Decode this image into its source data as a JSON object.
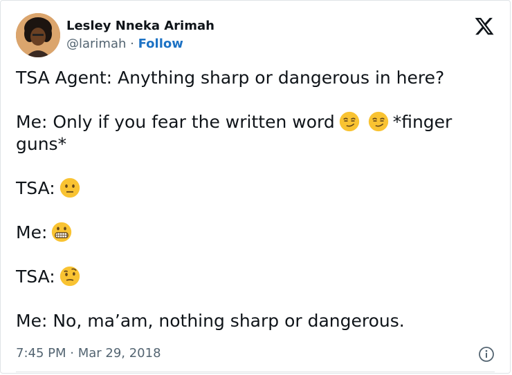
{
  "author": {
    "display_name": "Lesley Nneka Arimah",
    "handle": "@larimah",
    "separator": "·",
    "follow_label": "Follow"
  },
  "tweet": {
    "line1": "TSA Agent: Anything sharp or dangerous in here?",
    "line2_text": "Me: Only if you fear the written word",
    "line2_tail": "*finger guns*",
    "line3": "TSA:",
    "line4": "Me:",
    "line5": "TSA:",
    "line6": "Me: No, ma’am, nothing sharp or dangerous."
  },
  "meta": {
    "timestamp": "7:45 PM · Mar 29, 2018"
  },
  "icons": {
    "brand": "x-logo-icon",
    "info": "info-icon",
    "emojis": [
      "smirking-face",
      "smirking-face",
      "neutral-face",
      "grimacing-face",
      "face-with-raised-eyebrow"
    ]
  },
  "colors": {
    "text": "#0f1419",
    "secondary": "#536471",
    "link": "#1d72c4",
    "emoji_yellow": "#f9c332"
  }
}
